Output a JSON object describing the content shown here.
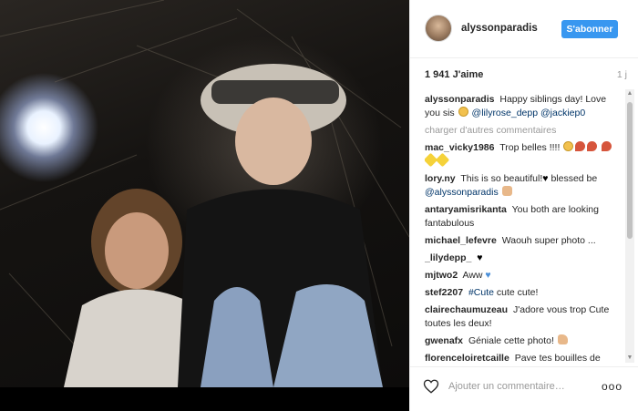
{
  "post": {
    "username": "alyssonparadis",
    "follow_label": "S'abonner",
    "likes": "1 941 J'aime",
    "time_ago": "1 j",
    "load_more": "charger d'autres commentaires",
    "add_comment_placeholder": "Ajouter un commentaire…",
    "more_label": "ooo"
  },
  "caption": {
    "user": "alyssonparadis",
    "text": "Happy siblings day! Love you sis",
    "mention1": "@lilyrose_depp",
    "mention2": "@jackiep0"
  },
  "comments": [
    {
      "user": "mac_vicky1986",
      "text": "Trop belles !!!!"
    },
    {
      "user": "lory.ny",
      "text": "This is so beautiful!",
      "text2": "blessed be",
      "mention": "@alyssonparadis"
    },
    {
      "user": "antaryamisrikanta",
      "text": "You both are looking fantabulous"
    },
    {
      "user": "michael_lefevre",
      "text": "Waouh super photo ..."
    },
    {
      "user": "_lilydepp_",
      "text": ""
    },
    {
      "user": "mjtwo2",
      "text": "Aww"
    },
    {
      "user": "stef2207",
      "text": "cute cute!",
      "mention": "#Cute"
    },
    {
      "user": "clairechaumuzeau",
      "text": "J'adore vous trop Cute toutes les deux!"
    },
    {
      "user": "gwenafx",
      "text": "Géniale cette photo!"
    },
    {
      "user": "florenceloiretcaille",
      "text": "Paye tes bouilles de l'Enfance!"
    }
  ],
  "icons": {
    "heart": "heart-outline-icon",
    "more": "more-options-icon"
  },
  "colors": {
    "accent": "#3897f0",
    "mention": "#003569",
    "muted": "#999999"
  }
}
